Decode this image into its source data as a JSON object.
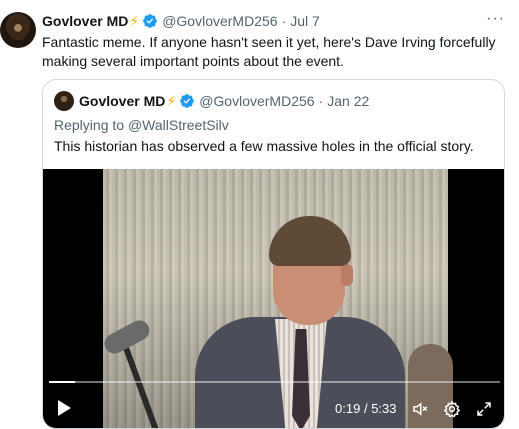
{
  "tweet": {
    "author_name": "Govlover MD",
    "author_emoji": "⚡",
    "handle": "@GovloverMD256",
    "separator": "·",
    "date": "Jul 7",
    "more_label": "···",
    "text": "Fantastic meme. If anyone hasn't seen it yet, here's Dave Irving forcefully making several important points about the event."
  },
  "quote": {
    "author_name": "Govlover MD",
    "author_emoji": "⚡",
    "handle": "@GovloverMD256",
    "separator": "·",
    "date": "Jan 22",
    "reply_prefix": "Replying to",
    "reply_handle": "@WallStreetSilv",
    "text": "This historian has observed a few massive holes in the official story."
  },
  "video": {
    "current_time": "0:19",
    "separator": "/",
    "duration": "5:33",
    "progress_fraction": 0.057
  },
  "colors": {
    "verified": "#1d9bf0",
    "bolt": "#f5b400",
    "secondary_text": "#536471",
    "border": "#cfd9de"
  }
}
